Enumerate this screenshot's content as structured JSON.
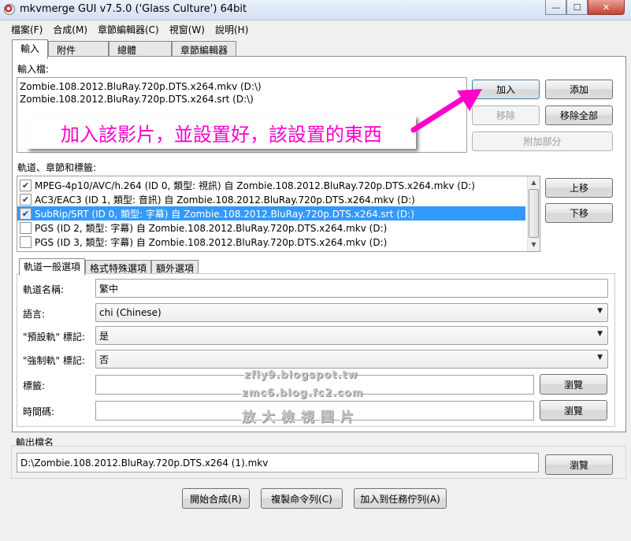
{
  "window": {
    "title": "mkvmerge GUI v7.5.0 ('Glass Culture') 64bit",
    "buttons": {
      "minimize": "—",
      "maximize": "☐",
      "close": "✕"
    }
  },
  "menu": [
    "檔案(F)",
    "合成(M)",
    "章節編輯器(C)",
    "視窗(W)",
    "說明(H)"
  ],
  "tabs": [
    "輸入",
    "附件",
    "總體",
    "章節編輯器"
  ],
  "input": {
    "files_label": "輸入檔:",
    "files": [
      "Zombie.108.2012.BluRay.720p.DTS.x264.mkv (D:\\)",
      "Zombie.108.2012.BluRay.720p.DTS.x264.srt (D:\\)"
    ],
    "buttons": {
      "add": "加入",
      "append": "添加",
      "remove": "移除",
      "remove_all": "移除全部",
      "additional_parts": "附加部分"
    },
    "tracks_label": "軌道、章節和標籤:",
    "tracks": [
      {
        "checked": true,
        "text": "MPEG-4p10/AVC/h.264 (ID 0, 類型: 視訊) 自 Zombie.108.2012.BluRay.720p.DTS.x264.mkv (D:)",
        "selected": false
      },
      {
        "checked": true,
        "text": "AC3/EAC3 (ID 1, 類型: 音訊) 自 Zombie.108.2012.BluRay.720p.DTS.x264.mkv (D:)",
        "selected": false
      },
      {
        "checked": true,
        "text": "SubRip/SRT (ID 0, 類型: 字幕) 自 Zombie.108.2012.BluRay.720p.DTS.x264.srt (D:)",
        "selected": true
      },
      {
        "checked": false,
        "text": "PGS (ID 2, 類型: 字幕) 自 Zombie.108.2012.BluRay.720p.DTS.x264.mkv (D:)",
        "selected": false
      },
      {
        "checked": false,
        "text": "PGS (ID 3, 類型: 字幕) 自 Zombie.108.2012.BluRay.720p.DTS.x264.mkv (D:)",
        "selected": false
      }
    ],
    "track_buttons": {
      "up": "上移",
      "down": "下移"
    },
    "subtabs": [
      "軌道一般選項",
      "格式特殊選項",
      "額外選項"
    ],
    "options": {
      "track_name_label": "軌道名稱:",
      "track_name_value": "繁中",
      "language_label": "語言:",
      "language_value": "chi (Chinese)",
      "default_flag_label": "\"預設軌\" 標記:",
      "default_flag_value": "是",
      "forced_flag_label": "\"強制軌\" 標記:",
      "forced_flag_value": "否",
      "tags_label": "標籤:",
      "tags_value": "",
      "timecodes_label": "時間碼:",
      "timecodes_value": "",
      "browse": "瀏覽"
    }
  },
  "output": {
    "label": "輸出檔名",
    "value": "D:\\Zombie.108.2012.BluRay.720p.DTS.x264 (1).mkv",
    "browse": "瀏覽"
  },
  "bottom_buttons": {
    "start": "開始合成(R)",
    "copy": "複製命令列(C)",
    "queue": "加入到任務佇列(A)"
  },
  "annotation": {
    "text": "加入該影片，並設置好，該設置的東西",
    "color": "#ff00cc"
  },
  "watermark": {
    "line1": "zfly9.blogspot.tw",
    "line2": "zmc6.blog.fc2.com",
    "line3": "放 大 檢 視 圖 片"
  }
}
